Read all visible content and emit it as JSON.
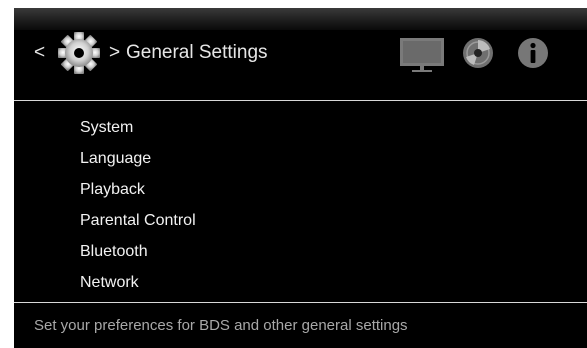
{
  "header": {
    "back_symbol": "<",
    "forward_symbol": ">",
    "title": "General Settings",
    "icons": [
      "gear-icon",
      "tv-icon",
      "disc-icon",
      "info-icon"
    ]
  },
  "menu": {
    "items": [
      {
        "label": "System"
      },
      {
        "label": "Language"
      },
      {
        "label": "Playback"
      },
      {
        "label": "Parental Control"
      },
      {
        "label": "Bluetooth"
      },
      {
        "label": "Network"
      }
    ]
  },
  "footer": {
    "description": "Set your preferences for BDS and other general settings"
  },
  "colors": {
    "background": "#000000",
    "text": "#f2f2f2",
    "footer_text": "#a8a8a8",
    "divider": "#d8d8d8",
    "icon_gray": "#777777"
  }
}
